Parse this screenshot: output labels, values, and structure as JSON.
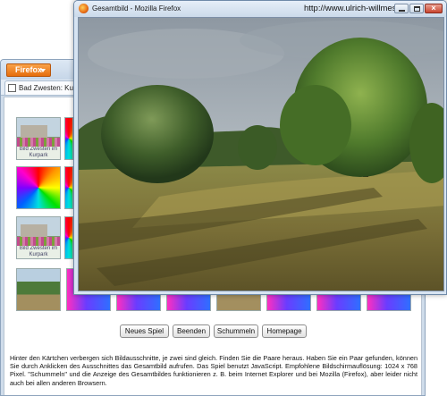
{
  "background_window": {
    "app_button": "Firefox",
    "tab_label": "Bad Zwesten: Kurpark",
    "tile_caption": "Bild Zwesten im Kurpark"
  },
  "buttons": {
    "new_game": "Neues Spiel",
    "quit": "Beenden",
    "cheat": "Schummeln",
    "homepage": "Homepage"
  },
  "description": "Hinter den Kärtchen verbergen sich Bildausschnitte, je zwei sind gleich. Finden Sie die Paare heraus. Haben Sie ein Paar gefunden, können Sie durch Anklicken des Ausschnittes das Gesamtbild aufrufen. Das Spiel benutzt JavaScript. Empfohlene Bildschirmauflösung: 1024 x 768 Pixel. \"Schummeln\" und die Anzeige des Gesamtbildes funktionieren z. B. beim Internet Explorer und bei Mozilla (Firefox), aber leider nicht auch bei allen anderen Browsern.",
  "popup": {
    "title": "Gesamtbild - Mozilla Firefox",
    "url": "http://www.ulrich-willmes.de",
    "image_name": "Gesamtbild"
  },
  "colors": {
    "firefox_orange": "#e66d0c",
    "window_frame": "#cfdcea"
  }
}
